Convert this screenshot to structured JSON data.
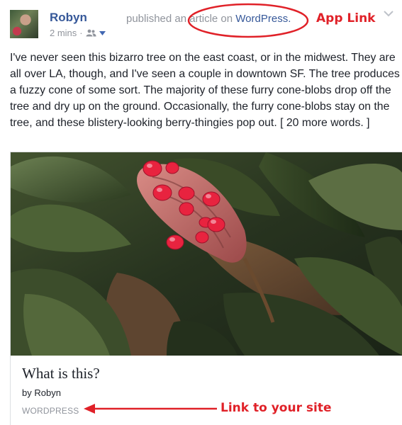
{
  "post": {
    "author": "Robyn",
    "time": "2 mins",
    "separator": "·",
    "published_prefix": "published an article on",
    "app_name": "WordPress.",
    "message": "I've never seen this bizarro tree on the east coast, or in the midwest. They are all over LA, though, and I've seen a couple in downtown SF. The tree produces a fuzzy cone of some sort. The majority of these furry cone-blobs drop off the tree and dry up on the ground. Occasionally, the furry cone-blobs stay on the tree, and these blistery-looking berry-thingies pop out. [ 20 more words. ]"
  },
  "card": {
    "title": "What is this?",
    "byline": "by Robyn",
    "domain": "WORDPRESS"
  },
  "annotations": {
    "app_link": "App Link",
    "site_link": "Link to your site",
    "color": "#e02128"
  },
  "icons": {
    "audience": "friends-icon",
    "caret": "caret-down-icon",
    "menu": "chevron-down-icon"
  },
  "colors": {
    "link": "#365899",
    "meta": "#90949c",
    "text": "#1d2129"
  }
}
